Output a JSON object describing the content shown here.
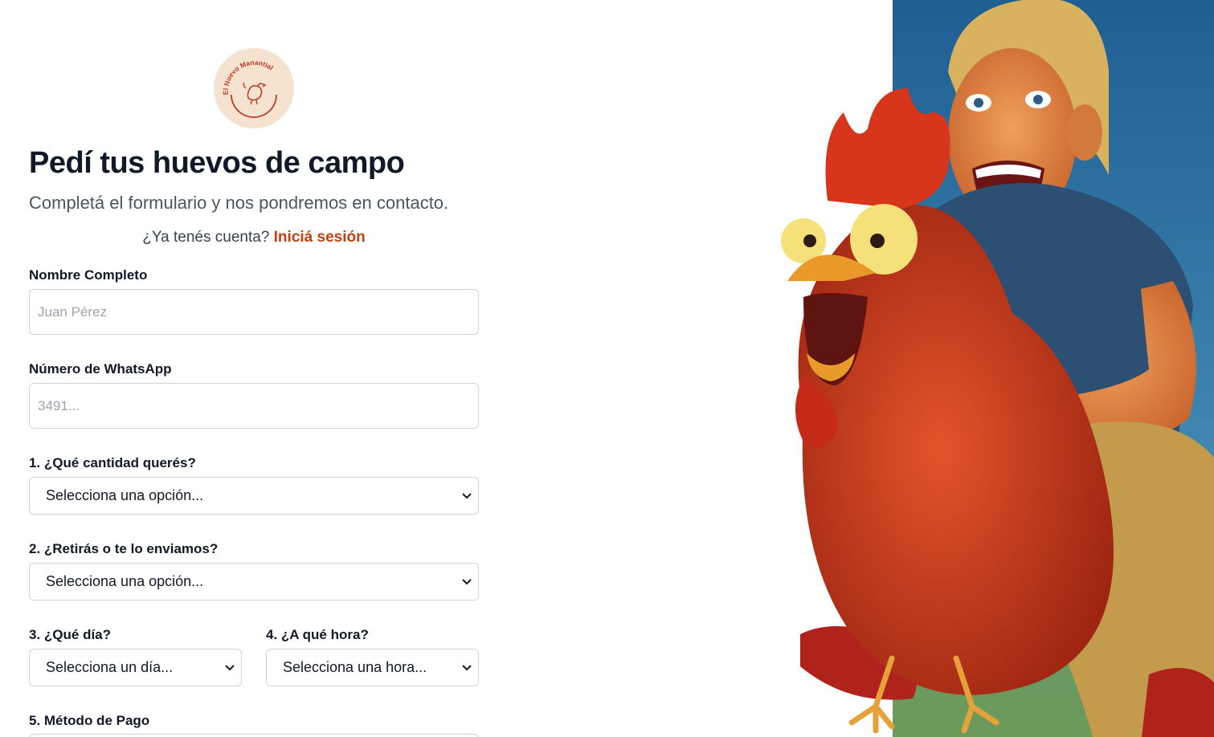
{
  "brand": {
    "logo_text": "El Nuevo Manantial",
    "logo_color": "#c0392b",
    "logo_bg": "#f6e3cf"
  },
  "header": {
    "title": "Pedí tus huevos de campo",
    "subtitle": "Completá el formulario y nos pondremos en contacto.",
    "login_prompt": "¿Ya tenés cuenta?",
    "login_link": "Iniciá sesión"
  },
  "form": {
    "name": {
      "label": "Nombre Completo",
      "placeholder": "Juan Pérez"
    },
    "whatsapp": {
      "label": "Número de WhatsApp",
      "placeholder": "3491..."
    },
    "quantity": {
      "label": "1. ¿Qué cantidad querés?",
      "value": "Selecciona una opción..."
    },
    "delivery": {
      "label": "2. ¿Retirás o te lo enviamos?",
      "value": "Selecciona una opción..."
    },
    "day": {
      "label": "3. ¿Qué día?",
      "value": "Selecciona un día..."
    },
    "hour": {
      "label": "4. ¿A qué hora?",
      "value": "Selecciona una hora..."
    },
    "payment": {
      "label": "5. Método de Pago"
    }
  },
  "icons": {
    "select_arrow": "chevron-down-icon",
    "logo": "hen-icon"
  },
  "colors": {
    "accent": "#c2410c",
    "text": "#111827",
    "muted": "#4b5563",
    "border": "#d1d5db"
  }
}
